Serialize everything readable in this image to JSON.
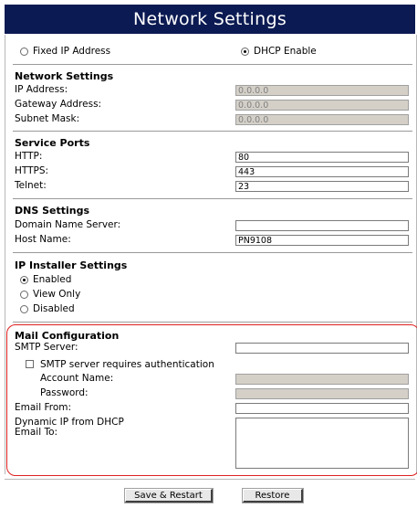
{
  "title": "Network Settings",
  "ip_mode": {
    "fixed_label": "Fixed IP Address",
    "dhcp_label": "DHCP Enable",
    "selected": "dhcp"
  },
  "network": {
    "heading": "Network Settings",
    "ip_label": "IP Address:",
    "ip_value": "0.0.0.0",
    "gateway_label": "Gateway Address:",
    "gateway_value": "0.0.0.0",
    "subnet_label": "Subnet Mask:",
    "subnet_value": "0.0.0.0"
  },
  "ports": {
    "heading": "Service Ports",
    "http_label": "HTTP:",
    "http_value": "80",
    "https_label": "HTTPS:",
    "https_value": "443",
    "telnet_label": "Telnet:",
    "telnet_value": "23"
  },
  "dns": {
    "heading": "DNS Settings",
    "dns_label": "Domain Name Server:",
    "dns_value": "",
    "host_label": "Host Name:",
    "host_value": "PN9108"
  },
  "installer": {
    "heading": "IP Installer Settings",
    "options": [
      "Enabled",
      "View Only",
      "Disabled"
    ],
    "selected": "Enabled"
  },
  "mail": {
    "heading": "Mail Configuration",
    "smtp_label": "SMTP Server:",
    "smtp_value": "",
    "auth_label": "SMTP server requires authentication",
    "auth_checked": false,
    "account_label": "Account Name:",
    "account_value": "",
    "password_label": "Password:",
    "password_value": "",
    "from_label": "Email From:",
    "from_value": "",
    "to_label_1": "Dynamic IP from DHCP",
    "to_label_2": "Email To:",
    "to_value": "",
    "highlight_color": "#e02020"
  },
  "buttons": {
    "save": "Save & Restart",
    "restore": "Restore"
  },
  "colors": {
    "title_bg": "#0b1a52",
    "disabled_field": "#d4d0c8"
  }
}
